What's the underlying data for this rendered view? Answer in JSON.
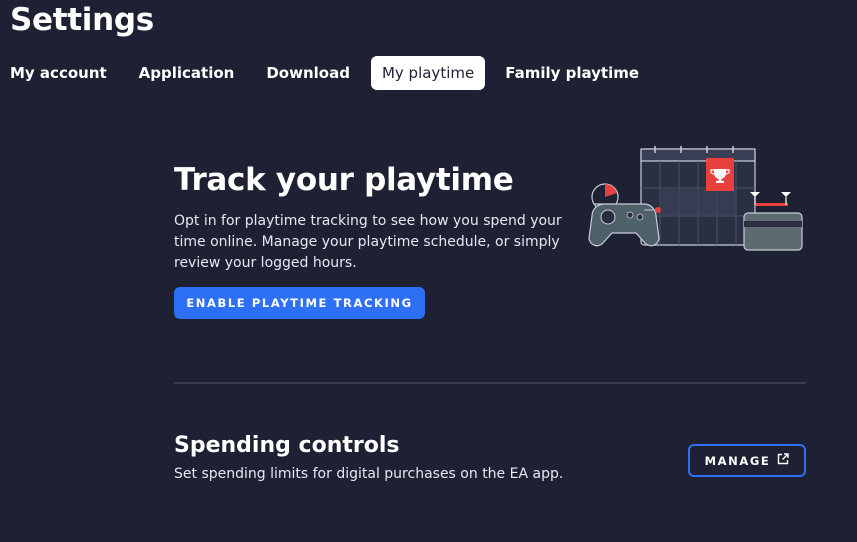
{
  "page": {
    "title": "Settings"
  },
  "tabs": [
    {
      "label": "My account",
      "active": false
    },
    {
      "label": "Application",
      "active": false
    },
    {
      "label": "Download",
      "active": false
    },
    {
      "label": "My playtime",
      "active": true
    },
    {
      "label": "Family playtime",
      "active": false
    }
  ],
  "playtime": {
    "title": "Track your playtime",
    "description": "Opt in for playtime tracking to see how you spend your time online. Manage your playtime schedule, or simply review your logged hours.",
    "enable_button": "ENABLE PLAYTIME TRACKING",
    "illustration_icons": [
      "calendar-icon",
      "trophy-icon",
      "gamepad-icon",
      "timer-icon",
      "card-icon"
    ]
  },
  "spending": {
    "title": "Spending controls",
    "description": "Set spending limits for digital purchases on the EA app.",
    "manage_button": "MANAGE",
    "manage_icon": "external-link-icon"
  },
  "colors": {
    "background": "#1e2133",
    "accent": "#2d6ff5",
    "highlight_red": "#e8403c"
  }
}
